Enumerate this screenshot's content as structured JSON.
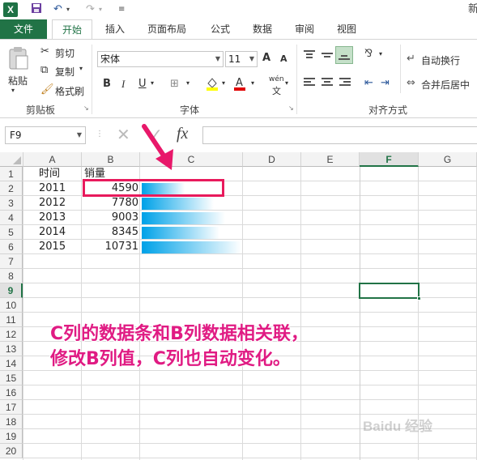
{
  "window": {
    "title_fragment": "新"
  },
  "ribbon_tabs": [
    "文件",
    "开始",
    "插入",
    "页面布局",
    "公式",
    "数据",
    "审阅",
    "视图"
  ],
  "clipboard": {
    "paste": "粘贴",
    "cut": "剪切",
    "copy": "复制",
    "format_painter": "格式刷",
    "group_label": "剪贴板"
  },
  "font": {
    "name": "宋体",
    "size": "11",
    "group_label": "字体",
    "bold": "B",
    "italic": "I",
    "underline": "U",
    "phonetic": "wén",
    "grow": "A",
    "shrink": "A"
  },
  "alignment": {
    "wrap_text": "自动换行",
    "merge_center": "合并后居中",
    "group_label": "对齐方式"
  },
  "formula_bar": {
    "name_box": "F9",
    "fx": "fx",
    "value": ""
  },
  "columns": [
    "A",
    "B",
    "C",
    "D",
    "E",
    "F",
    "G"
  ],
  "rows": [
    "1",
    "2",
    "3",
    "4",
    "5",
    "6",
    "7",
    "8",
    "9",
    "10",
    "11",
    "12",
    "13",
    "14",
    "15",
    "16",
    "17",
    "18",
    "19",
    "20"
  ],
  "sheet": {
    "header_time": "时间",
    "header_sales": "销量",
    "data": [
      {
        "year": "2011",
        "sales": "4590"
      },
      {
        "year": "2012",
        "sales": "7780"
      },
      {
        "year": "2013",
        "sales": "9003"
      },
      {
        "year": "2014",
        "sales": "8345"
      },
      {
        "year": "2015",
        "sales": "10731"
      }
    ],
    "bar_fraction": [
      0.428,
      0.725,
      0.839,
      0.778,
      1.0
    ],
    "selected_cell": "F9"
  },
  "annotation": {
    "line1": "C列的数据条和B列数据相关联，",
    "line2": "修改B列值，C列也自动变化。"
  },
  "watermark": "Baidu 经验",
  "colors": {
    "excel_green": "#217346",
    "annotation_pink": "#e01b83",
    "databar_blue": "#00a2e8"
  }
}
